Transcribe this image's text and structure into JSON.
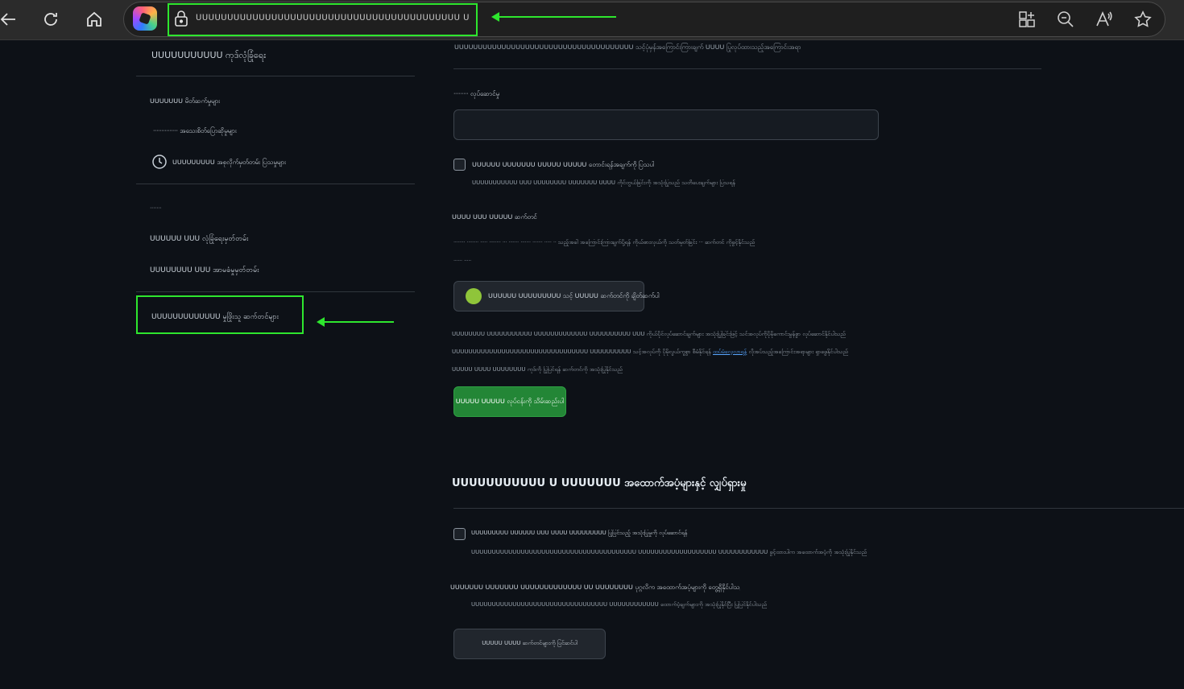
{
  "browser": {
    "url": "ᑌᑌᑌᑌᑌᑌᑌᑌᑌᑌᑌᑌᑌᑌᑌᑌᑌᑌᑌᑌᑌᑌᑌᑌᑌᑌᑌᑌᑌᑌᑌᑌᑌᑌᑌᑌᑌᑌᑌᑌᑌᑌ ᑌᑌᑌᑌᑌᑌᑌᑌᑌᑌᑌᑌᑌᑌᑌᑌᑌ",
    "icons": [
      "back-icon",
      "refresh-icon",
      "home-icon",
      "copilot-icon",
      "lock-icon",
      "apps-icon",
      "zoom-out-icon",
      "read-aloud-icon",
      "favorite-icon"
    ],
    "annotation_color": "#2ee62e"
  },
  "sidebar": {
    "items": [
      {
        "label": "ᑌᑌᑌᑌᑌᑌᑌᑌᑌᑌᑌ ကုဒ်လုံခြုံရေး"
      },
      {
        "label": "ᑌᑌᑌᑌᑌᑌᑌ မိတ်ဆက်မှုများ"
      },
      {
        "label": "ᐧᐧᐧᐧᐧᐧᐧᐧᐧᐧᐧᐧᐧᐧᐧ အသေးစိတ်ပြောဆိုမှုများ"
      },
      {
        "label": "ᑌᑌᑌᑌᑌᑌᑌᑌᑌ အစုလိုက်မှတ်တမ်း ပြသမှုများ"
      },
      {
        "label": "ᐧᐧᐧᐧᐧᐧᐧ"
      },
      {
        "label": "ᑌᑌᑌᑌᑌᑌ ᑌᑌᑌ လုံခြုံရေးမှတ်တမ်း"
      },
      {
        "label": "ᑌᑌᑌᑌᑌᑌᑌᑌ ᑌᑌᑌ အာမခံမှုမှတ်တမ်း"
      },
      {
        "label": "ᑌᑌᑌᑌᑌᑌᑌᑌᑌᑌᑌᑌᑌ မှုဖြိုးသူ ဆက်တင်များ"
      }
    ]
  },
  "main": {
    "top_text": "ᑌᑌᑌᑌᑌᑌᑌᑌᑌᑌᑌᑌᑌᑌᑌᑌᑌᑌᑌᑌᑌᑌᑌᑌᑌᑌᑌᑌᑌᑌᑌᑌᑌᑌᑌᑌᑌᑌ သင့်ပုံမှန်အကြောင်းကြားချက် ᑌᑌᑌᑌ ပြုလုပ်ထားသည့်အကြောင်းအရာ",
    "field_label": "ᐧᐧᐧᐧᐧᐧᐧᐧᐧ လုပ်ဆောင်မှု",
    "field_value": "",
    "checkbox1_label": "ᑌᑌᑌᑌᑌᑌ ᑌᑌᑌᑌᑌᑌᑌ ᑌᑌᑌᑌᑌ ᑌᑌᑌᑌᑌ တောင်းရန်အချက်ကို ပြသပါ",
    "checkbox1_desc": "ᑌᑌᑌᑌᑌᑌᑌᑌᑌᑌᑌ ᑌᑌᑌ ᑌᑌᑌᑌᑌᑌᑌᑌ ᑌᑌᑌᑌᑌᑌᑌ ᑌᑌᑌᑌ ကိုင်တွယ်ခြင်းကို အသုံးပြုသည် သတိပေးချက်များ ပြသရန်",
    "settings_heading": "ᑌᑌᑌᑌ ᑌᑌᑌ ᑌᑌᑌᑌᑌ ဆက်တင်",
    "settings_desc_1": "ᐧᐧᐧᐧᐧᐧᐧᐧ ᐧᐧᐧᐧᐧᐧᐧᐧ ᐧᐧᐧᐧᐧ ᐧᐧᐧᐧᐧᐧᐧᐧ ᐧᐧᐧ ᐧᐧᐧᐧᐧᐧᐧ ᐧᐧᐧᐧᐧᐧᐧ ᐧᐧᐧᐧᐧᐧᐧ ᐧᐧᐧᐧᐧ ᐧᐧ သည့်အခါ အကြောင်းကြားချက်ပို့ရန် ကိုယ်စားလှယ်ကို သတ်မှတ်ခြင်း ᐧᐧᐧ ဆက်တင် ကိုဖွင့်နိုင်သည်",
    "settings_desc_2": "ᐧᐧᐧᐧᐧᐧ ᐧᐧᐧᐧᐧ",
    "connect_button": "ᑌᑌᑌᑌᑌᑌ ᑌᑌᑌᑌᑌᑌᑌᑌᑌ သင့် ᑌᑌᑌᑌᑌ ဆက်တင်ကို ချိတ်ဆက်ပါ",
    "info_1": "ᑌᑌᑌᑌᑌᑌᑌᑌ ᑌᑌᑌᑌᑌᑌᑌᑌᑌᑌᑌ ᑌᑌᑌᑌᑌᑌᑌᑌᑌᑌᑌᑌᑌ ᑌᑌᑌᑌᑌᑌᑌᑌᑌᑌ ᑌᑌᑌ ကိုယ်ပိုင်လုပ်ဆောင်ချက်များ အသုံးပြုခြင်းဖြင့် သင်အလုပ်ကိုပိုမိုကောင်းမွန်စွာ လုပ်ဆောင်နိုင်ပါသည်",
    "info_2_prefix": "ᑌᑌᑌᑌᑌᑌᑌᑌᑌᑌᑌᑌᑌᑌᑌᑌᑌᑌᑌᑌᑌᑌᑌᑌᑌᑌᑌᑌᑌᑌᑌᑌᑌ ᑌᑌᑌᑌᑌᑌᑌᑌᑌᑌ သင့်အလုပ်ကို ပိုမိုလွယ်ကူစွာ စီမံနိုင်ရန်",
    "info_2_link": "ထပ်မံလေ့လာရန်",
    "info_2_suffix": "လိုအပ်သည့်အကြောင်းအရာများ ရှာဖွေနိုင်ပါသည်",
    "info_3": "ᑌᑌᑌᑌᑌ ᑌᑌᑌᑌ ᑌᑌᑌᑌᑌᑌᑌᑌ ကုဒ်ကို ပြုပြင်ရန် ဆက်တင်ကို အသုံးပြုနိုင်သည်",
    "save_button": "ᑌᑌᑌᑌᑌ ᑌᑌᑌᑌᑌ လုပ်ငန်းကို သိမ်းဆည်းပါ",
    "section_title": "ᑌᑌᑌᑌᑌᑌᑌᑌᑌᑌᑌ ᑌ ᑌᑌᑌᑌᑌᑌᑌ အထောက်အပံ့များနှင့် လျှပ်ရှားမှု",
    "checkbox2_label": "ᑌᑌᑌᑌᑌᑌᑌᑌᑌ ᑌᑌᑌᑌᑌᑌ ᑌᑌᑌ ᑌᑌᑌᑌ ᑌᑌᑌᑌᑌᑌᑌᑌᑌ ပြုပြင်သည့် အသုံးပြုမှုကို လုပ်ဆောင်ရန်",
    "checkbox2_desc": "ᑌᑌᑌᑌᑌᑌᑌᑌᑌᑌᑌᑌᑌᑌᑌᑌᑌᑌᑌᑌᑌᑌᑌᑌᑌᑌᑌᑌᑌᑌᑌᑌᑌᑌᑌᑌᑌᑌᑌᑌ ᑌᑌᑌᑌᑌᑌᑌᑌᑌᑌᑌᑌᑌᑌᑌᑌᑌᑌᑌ ᑌᑌᑌᑌᑌᑌᑌᑌᑌᑌᑌᑌ ဖွင့်ထားပါက အထောက်အပံ့ကို အသုံးပြုနိုင်သည်",
    "line_label": "ᑌᑌᑌᑌᑌᑌᑌ ᑌᑌᑌᑌᑌᑌᑌ ᑌᑌᑌᑌᑌᑌᑌᑌᑌᑌᑌᑌᑌ ᑌᑌ ᑌᑌᑌᑌᑌᑌᑌᑌ ပုဂ္ဂလိက အထောက်အပံ့များကို တွေ့ရှိနိုင်ပါသည်",
    "line_desc": "ᑌᑌᑌᑌᑌᑌᑌᑌᑌᑌᑌᑌᑌᑌᑌᑌᑌᑌᑌᑌᑌᑌᑌᑌᑌᑌᑌᑌᑌᑌᑌᑌᑌ ᑌᑌᑌᑌᑌᑌᑌᑌᑌᑌᑌᑌ ထောက်ပံ့ချက်များကို အသုံးပြုနိုင်ပြီး ပြုပြင်နိုင်ပါသည်",
    "bottom_button": "ᑌᑌᑌᑌᑌ ᑌᑌᑌᑌ ဆက်တင်များကို ပြင်ဆင်ပါ"
  }
}
